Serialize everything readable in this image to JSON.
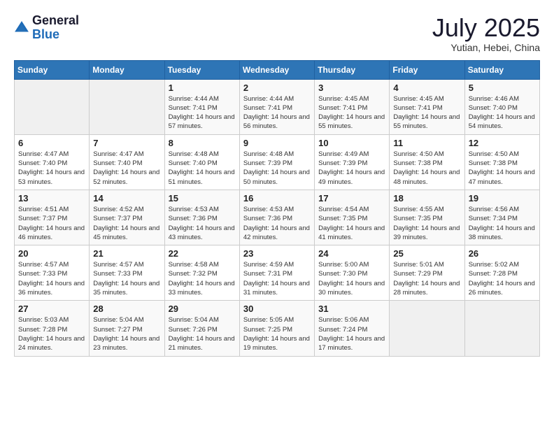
{
  "header": {
    "logo_general": "General",
    "logo_blue": "Blue",
    "month": "July 2025",
    "location": "Yutian, Hebei, China"
  },
  "weekdays": [
    "Sunday",
    "Monday",
    "Tuesday",
    "Wednesday",
    "Thursday",
    "Friday",
    "Saturday"
  ],
  "weeks": [
    [
      {
        "day": "",
        "info": ""
      },
      {
        "day": "",
        "info": ""
      },
      {
        "day": "1",
        "info": "Sunrise: 4:44 AM\nSunset: 7:41 PM\nDaylight: 14 hours and 57 minutes."
      },
      {
        "day": "2",
        "info": "Sunrise: 4:44 AM\nSunset: 7:41 PM\nDaylight: 14 hours and 56 minutes."
      },
      {
        "day": "3",
        "info": "Sunrise: 4:45 AM\nSunset: 7:41 PM\nDaylight: 14 hours and 55 minutes."
      },
      {
        "day": "4",
        "info": "Sunrise: 4:45 AM\nSunset: 7:41 PM\nDaylight: 14 hours and 55 minutes."
      },
      {
        "day": "5",
        "info": "Sunrise: 4:46 AM\nSunset: 7:40 PM\nDaylight: 14 hours and 54 minutes."
      }
    ],
    [
      {
        "day": "6",
        "info": "Sunrise: 4:47 AM\nSunset: 7:40 PM\nDaylight: 14 hours and 53 minutes."
      },
      {
        "day": "7",
        "info": "Sunrise: 4:47 AM\nSunset: 7:40 PM\nDaylight: 14 hours and 52 minutes."
      },
      {
        "day": "8",
        "info": "Sunrise: 4:48 AM\nSunset: 7:40 PM\nDaylight: 14 hours and 51 minutes."
      },
      {
        "day": "9",
        "info": "Sunrise: 4:48 AM\nSunset: 7:39 PM\nDaylight: 14 hours and 50 minutes."
      },
      {
        "day": "10",
        "info": "Sunrise: 4:49 AM\nSunset: 7:39 PM\nDaylight: 14 hours and 49 minutes."
      },
      {
        "day": "11",
        "info": "Sunrise: 4:50 AM\nSunset: 7:38 PM\nDaylight: 14 hours and 48 minutes."
      },
      {
        "day": "12",
        "info": "Sunrise: 4:50 AM\nSunset: 7:38 PM\nDaylight: 14 hours and 47 minutes."
      }
    ],
    [
      {
        "day": "13",
        "info": "Sunrise: 4:51 AM\nSunset: 7:37 PM\nDaylight: 14 hours and 46 minutes."
      },
      {
        "day": "14",
        "info": "Sunrise: 4:52 AM\nSunset: 7:37 PM\nDaylight: 14 hours and 45 minutes."
      },
      {
        "day": "15",
        "info": "Sunrise: 4:53 AM\nSunset: 7:36 PM\nDaylight: 14 hours and 43 minutes."
      },
      {
        "day": "16",
        "info": "Sunrise: 4:53 AM\nSunset: 7:36 PM\nDaylight: 14 hours and 42 minutes."
      },
      {
        "day": "17",
        "info": "Sunrise: 4:54 AM\nSunset: 7:35 PM\nDaylight: 14 hours and 41 minutes."
      },
      {
        "day": "18",
        "info": "Sunrise: 4:55 AM\nSunset: 7:35 PM\nDaylight: 14 hours and 39 minutes."
      },
      {
        "day": "19",
        "info": "Sunrise: 4:56 AM\nSunset: 7:34 PM\nDaylight: 14 hours and 38 minutes."
      }
    ],
    [
      {
        "day": "20",
        "info": "Sunrise: 4:57 AM\nSunset: 7:33 PM\nDaylight: 14 hours and 36 minutes."
      },
      {
        "day": "21",
        "info": "Sunrise: 4:57 AM\nSunset: 7:33 PM\nDaylight: 14 hours and 35 minutes."
      },
      {
        "day": "22",
        "info": "Sunrise: 4:58 AM\nSunset: 7:32 PM\nDaylight: 14 hours and 33 minutes."
      },
      {
        "day": "23",
        "info": "Sunrise: 4:59 AM\nSunset: 7:31 PM\nDaylight: 14 hours and 31 minutes."
      },
      {
        "day": "24",
        "info": "Sunrise: 5:00 AM\nSunset: 7:30 PM\nDaylight: 14 hours and 30 minutes."
      },
      {
        "day": "25",
        "info": "Sunrise: 5:01 AM\nSunset: 7:29 PM\nDaylight: 14 hours and 28 minutes."
      },
      {
        "day": "26",
        "info": "Sunrise: 5:02 AM\nSunset: 7:28 PM\nDaylight: 14 hours and 26 minutes."
      }
    ],
    [
      {
        "day": "27",
        "info": "Sunrise: 5:03 AM\nSunset: 7:28 PM\nDaylight: 14 hours and 24 minutes."
      },
      {
        "day": "28",
        "info": "Sunrise: 5:04 AM\nSunset: 7:27 PM\nDaylight: 14 hours and 23 minutes."
      },
      {
        "day": "29",
        "info": "Sunrise: 5:04 AM\nSunset: 7:26 PM\nDaylight: 14 hours and 21 minutes."
      },
      {
        "day": "30",
        "info": "Sunrise: 5:05 AM\nSunset: 7:25 PM\nDaylight: 14 hours and 19 minutes."
      },
      {
        "day": "31",
        "info": "Sunrise: 5:06 AM\nSunset: 7:24 PM\nDaylight: 14 hours and 17 minutes."
      },
      {
        "day": "",
        "info": ""
      },
      {
        "day": "",
        "info": ""
      }
    ]
  ]
}
